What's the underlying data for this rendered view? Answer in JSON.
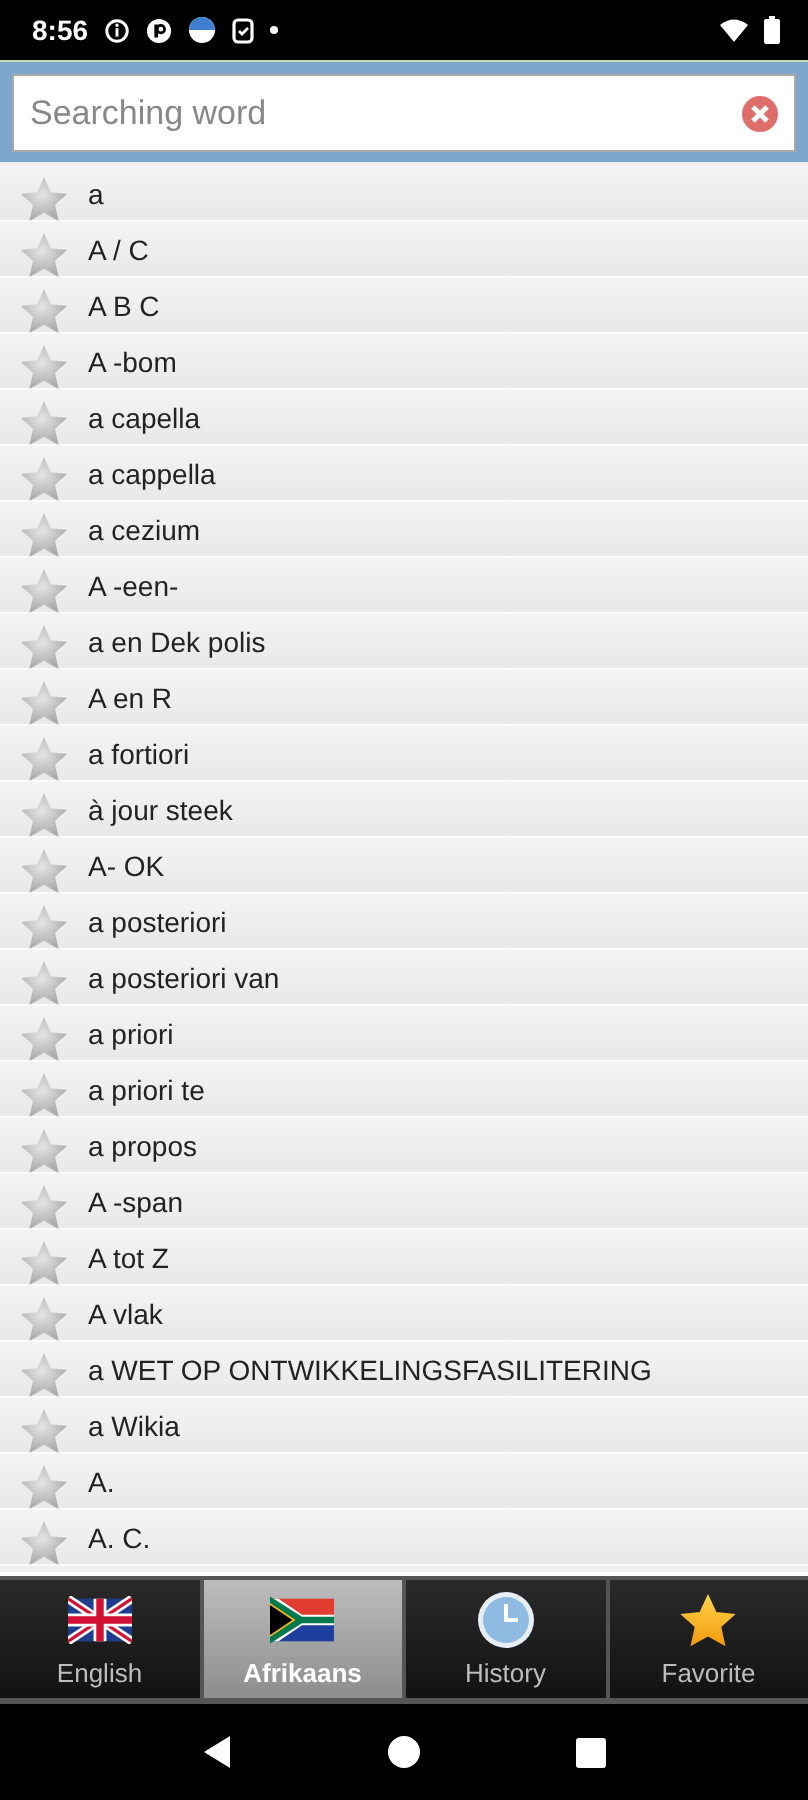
{
  "status_bar": {
    "time": "8:56"
  },
  "search": {
    "placeholder": "Searching word"
  },
  "words": [
    {
      "text": "a",
      "favorite": false
    },
    {
      "text": "A / C",
      "favorite": false
    },
    {
      "text": "A B C",
      "favorite": false
    },
    {
      "text": "A -bom",
      "favorite": false
    },
    {
      "text": "a capella",
      "favorite": false
    },
    {
      "text": "a cappella",
      "favorite": false
    },
    {
      "text": "a cezium",
      "favorite": false
    },
    {
      "text": "A -een-",
      "favorite": false
    },
    {
      "text": "a en Dek polis",
      "favorite": false
    },
    {
      "text": "A en R",
      "favorite": false
    },
    {
      "text": "a fortiori",
      "favorite": false
    },
    {
      "text": "à jour steek",
      "favorite": false
    },
    {
      "text": "A- OK",
      "favorite": false
    },
    {
      "text": "a posteriori",
      "favorite": false
    },
    {
      "text": "a posteriori van",
      "favorite": false
    },
    {
      "text": "a priori",
      "favorite": false
    },
    {
      "text": "a priori te",
      "favorite": false
    },
    {
      "text": "a propos",
      "favorite": false
    },
    {
      "text": "A -span",
      "favorite": false
    },
    {
      "text": "A tot Z",
      "favorite": false
    },
    {
      "text": "A vlak",
      "favorite": false
    },
    {
      "text": "a WET OP ONTWIKKELINGSFASILITERING",
      "favorite": false
    },
    {
      "text": "a Wikia",
      "favorite": false
    },
    {
      "text": "A.",
      "favorite": false
    },
    {
      "text": "A. C.",
      "favorite": false
    }
  ],
  "tabs": [
    {
      "label": "English",
      "kind": "uk",
      "selected": false
    },
    {
      "label": "Afrikaans",
      "kind": "za",
      "selected": true
    },
    {
      "label": "History",
      "kind": "clock",
      "selected": false
    },
    {
      "label": "Favorite",
      "kind": "star",
      "selected": false
    }
  ]
}
